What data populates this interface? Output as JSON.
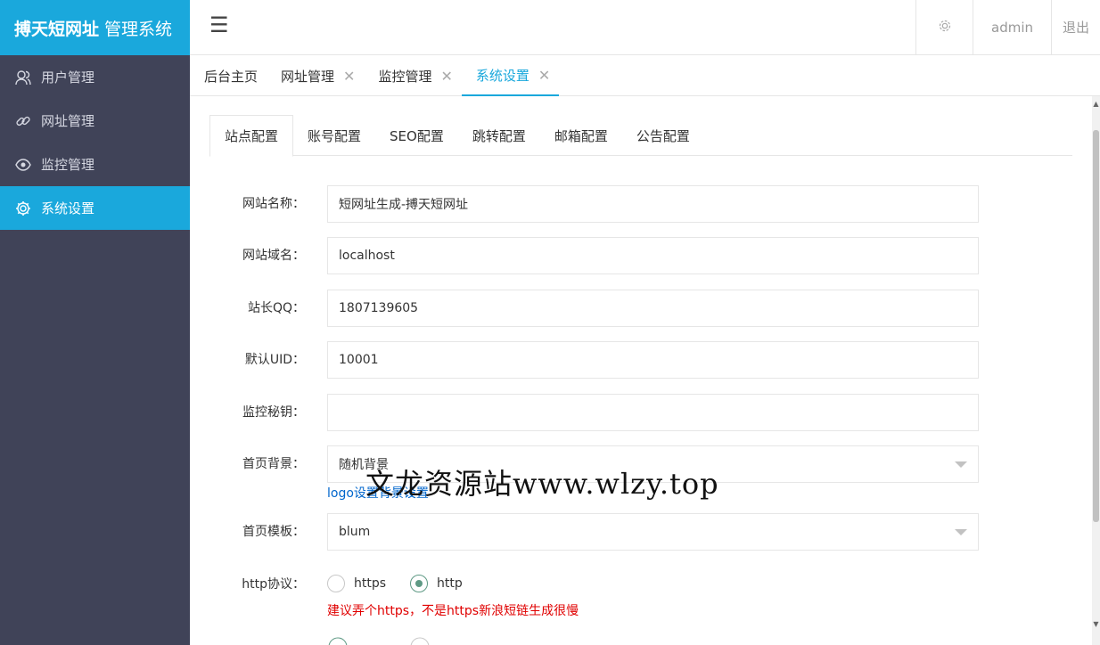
{
  "brand": {
    "name_bold": "搏天短网址",
    "name_rest": "管理系统"
  },
  "sidebar": {
    "items": [
      {
        "label": "用户管理",
        "icon": "user-icon"
      },
      {
        "label": "网址管理",
        "icon": "link-icon"
      },
      {
        "label": "监控管理",
        "icon": "eye-icon"
      },
      {
        "label": "系统设置",
        "icon": "gear-icon",
        "active": true
      }
    ]
  },
  "header": {
    "menu_icon": "☰",
    "user": "admin",
    "logout": "退出"
  },
  "page_tabs": [
    {
      "label": "后台主页",
      "closable": false
    },
    {
      "label": "网址管理",
      "closable": true
    },
    {
      "label": "监控管理",
      "closable": true
    },
    {
      "label": "系统设置",
      "closable": true,
      "active": true
    }
  ],
  "close_glyph": "✕",
  "sub_tabs": [
    "站点配置",
    "账号配置",
    "SEO配置",
    "跳转配置",
    "邮箱配置",
    "公告配置"
  ],
  "form": {
    "site_name": {
      "label": "网站名称：",
      "value": "短网址生成-搏天短网址"
    },
    "domain": {
      "label": "网站域名：",
      "value": "localhost"
    },
    "qq": {
      "label": "站长QQ：",
      "value": "1807139605"
    },
    "uid": {
      "label": "默认UID：",
      "value": "10001"
    },
    "monitor_key": {
      "label": "监控秘钥：",
      "value": ""
    },
    "background": {
      "label": "首页背景：",
      "value": "随机背景",
      "link_logo": "logo设置",
      "link_bg": "背景设置"
    },
    "template": {
      "label": "首页模板：",
      "value": "blum"
    },
    "protocol": {
      "label": "http协议：",
      "options": [
        "https",
        "http"
      ],
      "selected": "http",
      "hint": "建议弄个https，不是https新浪短链生成很慢"
    }
  },
  "watermark": "文龙资源站www.wlzy.top",
  "colors": {
    "accent": "#1aa8dc",
    "sidebar_bg": "#404358",
    "hint": "#e00000",
    "radio_on": "#5f9a85"
  }
}
